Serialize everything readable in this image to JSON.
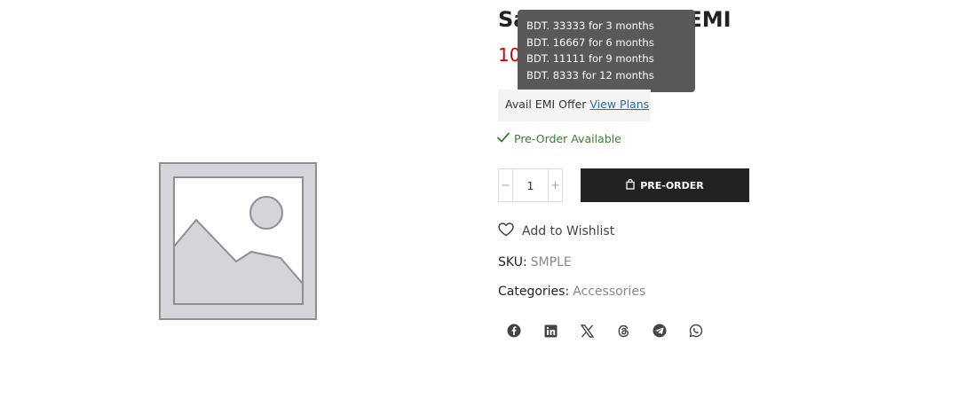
{
  "product": {
    "title_visible": "Sa",
    "title_tail": "t EMI",
    "price_visible": "10"
  },
  "emi": {
    "tooltip_lines": [
      "BDT. 33333 for 3 months",
      "BDT. 16667 for 6 months",
      "BDT. 11111 for 9 months",
      "BDT. 8333 for 12 months"
    ],
    "offer_label": "Avail EMI Offer",
    "link_label": "View Plans"
  },
  "stock": {
    "status_label": "Pre-Order Available",
    "icon": "check-icon"
  },
  "cart": {
    "quantity": "1",
    "minus_label": "−",
    "plus_label": "+",
    "preorder_label": "PRE-ORDER",
    "preorder_icon": "bag-icon"
  },
  "wishlist": {
    "label": "Add to Wishlist",
    "icon": "heart-icon"
  },
  "meta": {
    "sku_label": "SKU:",
    "sku_value": "SMPLE",
    "categories_label": "Categories:",
    "categories_value": "Accessories"
  },
  "share": {
    "icons": [
      "facebook-icon",
      "linkedin-icon",
      "x-icon",
      "threads-icon",
      "telegram-icon",
      "whatsapp-icon"
    ]
  },
  "colors": {
    "price": "#d10000",
    "stock": "#3a7c32",
    "link": "#1e6fb8",
    "button_bg": "#222222",
    "tooltip_bg": "#595959"
  }
}
